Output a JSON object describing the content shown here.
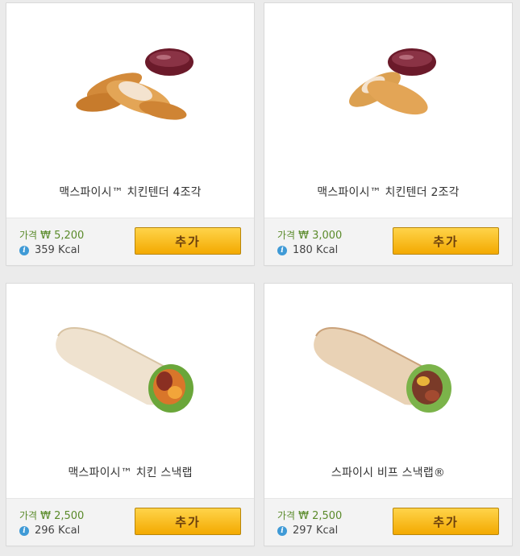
{
  "products": [
    {
      "name": "맥스파이시™ 치킨텐더 4조각",
      "price_label": "가격",
      "price": "₩ 5,200",
      "kcal": "359 Kcal",
      "add_label": "추가",
      "image": "chicken-tenders-4pc"
    },
    {
      "name": "맥스파이시™ 치킨텐더 2조각",
      "price_label": "가격",
      "price": "₩ 3,000",
      "kcal": "180 Kcal",
      "add_label": "추가",
      "image": "chicken-tenders-2pc"
    },
    {
      "name": "맥스파이시™ 치킨 스낵랩",
      "price_label": "가격",
      "price": "₩ 2,500",
      "kcal": "296 Kcal",
      "add_label": "추가",
      "image": "chicken-snack-wrap"
    },
    {
      "name": "스파이시 비프 스낵랩®",
      "price_label": "가격",
      "price": "₩ 2,500",
      "kcal": "297 Kcal",
      "add_label": "추가",
      "image": "beef-snack-wrap"
    }
  ],
  "colors": {
    "button": "#f7b500",
    "price_text": "#5a8a2a",
    "info_icon": "#3f9ad6"
  }
}
